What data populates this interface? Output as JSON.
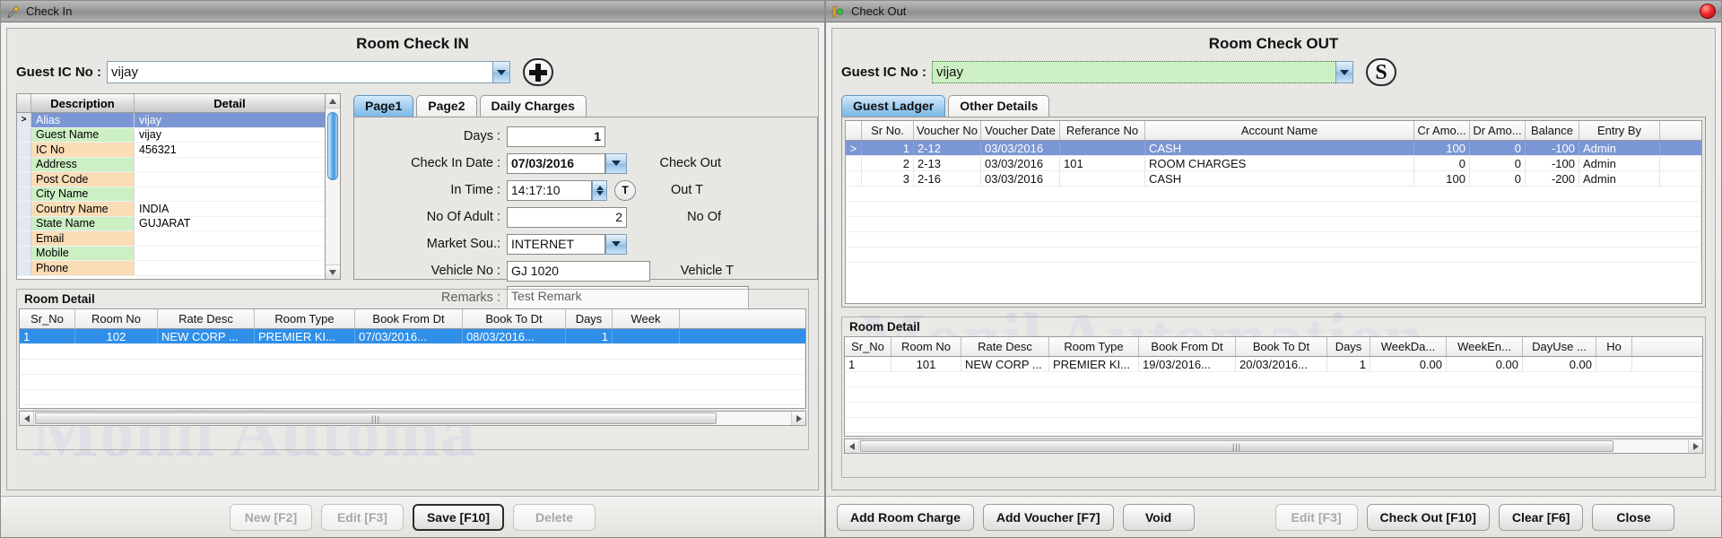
{
  "checkin": {
    "window_title": "Check In",
    "form_title": "Room Check IN",
    "guest_ic_label": "Guest IC No :",
    "guest_ic_value": "vijay",
    "add_button_icon": "plus-icon",
    "info_grid": {
      "headers": [
        "",
        "Description",
        "Detail"
      ],
      "rows": [
        {
          "marker": ">",
          "description": "Alias",
          "detail": "vijay",
          "selected": true
        },
        {
          "marker": "",
          "description": "Guest Name",
          "detail": "vijay",
          "selected": false
        },
        {
          "marker": "",
          "description": "IC No",
          "detail": "456321",
          "selected": false
        },
        {
          "marker": "",
          "description": "Address",
          "detail": "",
          "selected": false
        },
        {
          "marker": "",
          "description": "Post Code",
          "detail": "",
          "selected": false
        },
        {
          "marker": "",
          "description": "City Name",
          "detail": "",
          "selected": false
        },
        {
          "marker": "",
          "description": "Country Name",
          "detail": "INDIA",
          "selected": false
        },
        {
          "marker": "",
          "description": "State Name",
          "detail": "GUJARAT",
          "selected": false
        },
        {
          "marker": "",
          "description": "Email",
          "detail": "",
          "selected": false
        },
        {
          "marker": "",
          "description": "Mobile",
          "detail": "",
          "selected": false
        },
        {
          "marker": "",
          "description": "Phone",
          "detail": "",
          "selected": false
        }
      ]
    },
    "tabs": [
      {
        "label": "Page1",
        "active": true
      },
      {
        "label": "Page2",
        "active": false
      },
      {
        "label": "Daily Charges",
        "active": false
      }
    ],
    "fields": {
      "days_label": "Days :",
      "days_value": "1",
      "checkin_date_label": "Check In Date :",
      "checkin_date_value": "07/03/2016",
      "checkout_label": "Check Out",
      "in_time_label": "In Time :",
      "in_time_value": "14:17:10",
      "out_time_label": "Out T",
      "time_button_label": "T",
      "adult_label": "No Of Adult :",
      "adult_value": "2",
      "no_of_label": "No Of",
      "market_label": "Market Sou.:",
      "market_value": "INTERNET",
      "vehicle_label": "Vehicle No :",
      "vehicle_value": "GJ 1020",
      "vehicle_type_label": "Vehicle T",
      "remarks_label": "Remarks :",
      "remarks_value": "Test Remark"
    },
    "room_detail": {
      "group_title": "Room Detail",
      "headers": [
        "Sr_No",
        "Room No",
        "Rate Desc",
        "Room Type",
        "Book From Dt",
        "Book To Dt",
        "Days",
        "Week"
      ],
      "rows": [
        {
          "sr_no": "1",
          "room_no": "102",
          "rate_desc": "NEW CORP ...",
          "room_type": "PREMIER KI...",
          "book_from": "07/03/2016...",
          "book_to": "08/03/2016...",
          "days": "1",
          "week": "",
          "selected": true
        }
      ]
    },
    "watermark": "Monil Automa",
    "buttons": [
      {
        "label": "New [F2]",
        "state": "disabled"
      },
      {
        "label": "Edit [F3]",
        "state": "disabled"
      },
      {
        "label": "Save [F10]",
        "state": "focused"
      },
      {
        "label": "Delete",
        "state": "disabled"
      }
    ]
  },
  "checkout": {
    "window_title": "Check Out",
    "form_title": "Room Check OUT",
    "guest_ic_label": "Guest IC No :",
    "guest_ic_value": "vijay",
    "search_button_label": "S",
    "tabs": [
      {
        "label": "Guest Ladger",
        "active": true
      },
      {
        "label": "Other Details",
        "active": false
      }
    ],
    "ledger": {
      "headers": [
        "",
        "Sr No.",
        "Voucher No",
        "Voucher Date",
        "Referance No",
        "Account Name",
        "Cr Amo...",
        "Dr Amo...",
        "Balance",
        "Entry By"
      ],
      "rows": [
        {
          "marker": ">",
          "sr_no": "1",
          "voucher_no": "2-12",
          "voucher_date": "03/03/2016",
          "reference_no": "",
          "account_name": "CASH",
          "cr_amount": "100",
          "dr_amount": "0",
          "balance": "-100",
          "entry_by": "Admin",
          "selected": true
        },
        {
          "marker": "",
          "sr_no": "2",
          "voucher_no": "2-13",
          "voucher_date": "03/03/2016",
          "reference_no": "101",
          "account_name": "ROOM CHARGES",
          "cr_amount": "0",
          "dr_amount": "0",
          "balance": "-100",
          "entry_by": "Admin",
          "selected": false
        },
        {
          "marker": "",
          "sr_no": "3",
          "voucher_no": "2-16",
          "voucher_date": "03/03/2016",
          "reference_no": "",
          "account_name": "CASH",
          "cr_amount": "100",
          "dr_amount": "0",
          "balance": "-200",
          "entry_by": "Admin",
          "selected": false
        }
      ]
    },
    "room_detail": {
      "group_title": "Room Detail",
      "headers": [
        "Sr_No",
        "Room No",
        "Rate Desc",
        "Room Type",
        "Book From Dt",
        "Book To Dt",
        "Days",
        "WeekDa...",
        "WeekEn...",
        "DayUse ...",
        "Ho"
      ],
      "rows": [
        {
          "sr_no": "1",
          "room_no": "101",
          "rate_desc": "NEW CORP ...",
          "room_type": "PREMIER KI...",
          "book_from": "19/03/2016...",
          "book_to": "20/03/2016...",
          "days": "1",
          "weekday": "0.00",
          "weekend": "0.00",
          "dayuse": "0.00",
          "ho": ""
        }
      ]
    },
    "watermark": "Monil Automation",
    "buttons": [
      {
        "label": "Add Room Charge",
        "state": "normal"
      },
      {
        "label": "Add Voucher [F7]",
        "state": "normal"
      },
      {
        "label": "Void",
        "state": "normal"
      },
      {
        "label": "Edit [F3]",
        "state": "disabled"
      },
      {
        "label": "Check Out [F10]",
        "state": "normal"
      },
      {
        "label": "Clear [F6]",
        "state": "normal"
      },
      {
        "label": "Close",
        "state": "normal"
      }
    ]
  }
}
